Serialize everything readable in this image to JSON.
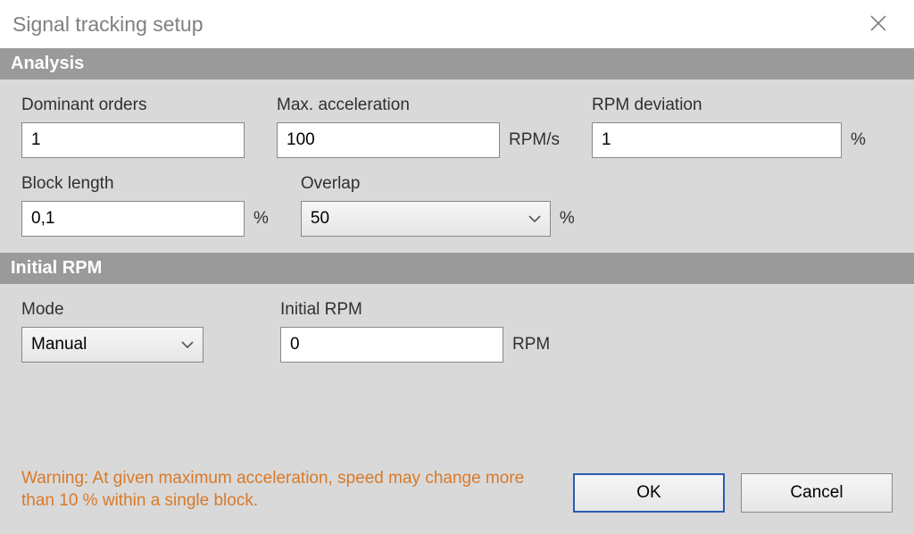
{
  "window": {
    "title": "Signal tracking setup"
  },
  "sections": {
    "analysis": {
      "header": "Analysis",
      "dominant_orders": {
        "label": "Dominant orders",
        "value": "1"
      },
      "max_acceleration": {
        "label": "Max. acceleration",
        "value": "100",
        "unit": "RPM/s"
      },
      "rpm_deviation": {
        "label": "RPM deviation",
        "value": "1",
        "unit": "%"
      },
      "block_length": {
        "label": "Block length",
        "value": "0,1",
        "unit": "%"
      },
      "overlap": {
        "label": "Overlap",
        "value": "50",
        "unit": "%"
      }
    },
    "initial_rpm": {
      "header": "Initial RPM",
      "mode": {
        "label": "Mode",
        "value": "Manual"
      },
      "initial_rpm_field": {
        "label": "Initial RPM",
        "value": "0",
        "unit": "RPM"
      }
    }
  },
  "warning": "Warning: At given maximum acceleration, speed may change more than 10 % within a single block.",
  "buttons": {
    "ok": "OK",
    "cancel": "Cancel"
  }
}
